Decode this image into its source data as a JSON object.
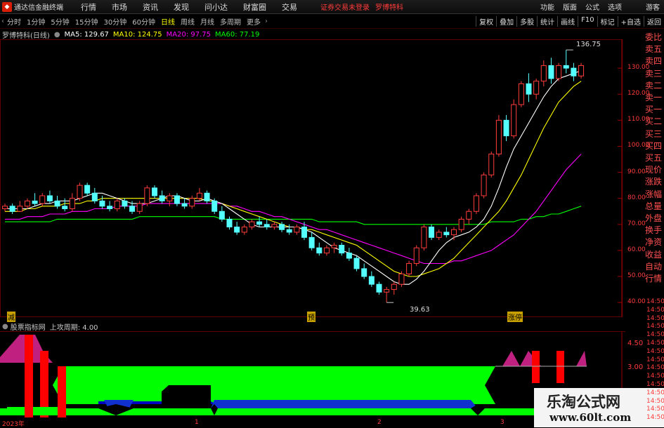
{
  "titlebar": {
    "app_title": "通达信金融终端",
    "menus": [
      "行情",
      "市场",
      "资讯",
      "发现",
      "问小达",
      "财富圈",
      "交易"
    ],
    "alert": "证券交易未登录",
    "stock": "罗博特科",
    "right_menus": [
      "功能",
      "版面",
      "公式",
      "选项"
    ],
    "guest": "游客"
  },
  "toolbar": {
    "periods": [
      "分时",
      "1分钟",
      "5分钟",
      "15分钟",
      "30分钟",
      "60分钟",
      "日线",
      "周线",
      "月线",
      "多周期",
      "更多"
    ],
    "active_period": "日线",
    "right_tools": [
      "复权",
      "叠加",
      "多股",
      "统计",
      "画线",
      "F10",
      "标记",
      "+自选",
      "返回"
    ]
  },
  "chart_info": {
    "stock_label": "罗博特科(日线)",
    "ma5": "MA5: 129.67",
    "ma10": "MA10: 124.75",
    "ma20": "MA20: 97.75",
    "ma60": "MA60: 77.19",
    "high_label": "136.75",
    "low_label": "39.63",
    "marker_left": "减",
    "marker_mid": "预",
    "marker_right": "涨停"
  },
  "side_panel": [
    "委比",
    "卖五",
    "卖四",
    "卖三",
    "卖二",
    "卖一",
    "买一",
    "买二",
    "买三",
    "买四",
    "买五",
    "现价",
    "涨跌",
    "涨幅",
    "总量",
    "外盘",
    "换手",
    "净资",
    "收益",
    "自动",
    "行情"
  ],
  "price_axis": [
    "130.00",
    "120.00",
    "110.00",
    "100.00",
    "90.00",
    "80.00",
    "70.00",
    "60.00",
    "50.00",
    "40.00"
  ],
  "indicator": {
    "name": "股票指标网",
    "param": "上攻周期: 4.00",
    "axis": [
      "4.50",
      "3.00"
    ]
  },
  "time_labels": [
    "2023年",
    "1",
    "2",
    "3"
  ],
  "time_right": [
    "14:50",
    "14:50",
    "14:50",
    "14:50",
    "14:50",
    "14:50",
    "14:50",
    "14:50",
    "14:50",
    "14:50",
    "14:50",
    "14:50",
    "14:50",
    "14:50",
    "14:50"
  ],
  "watermark": {
    "title": "乐淘公式网",
    "url": "www.60lt.com"
  },
  "colors": {
    "up": "#ff3c3c",
    "down": "#54ffff",
    "ma5": "#ffffff",
    "ma10": "#ffff00",
    "ma20": "#ff00ff",
    "ma60": "#00ff00"
  },
  "chart_data": {
    "type": "candlestick",
    "ylim": [
      36,
      140
    ],
    "candles": [
      [
        76,
        78,
        75,
        77
      ],
      [
        77,
        78,
        74,
        75
      ],
      [
        75,
        79,
        75,
        77
      ],
      [
        77,
        80,
        76,
        79
      ],
      [
        79,
        82,
        77,
        78
      ],
      [
        78,
        82,
        77,
        81
      ],
      [
        81,
        83,
        78,
        79
      ],
      [
        79,
        81,
        76,
        77
      ],
      [
        77,
        80,
        75,
        76
      ],
      [
        76,
        82,
        75,
        80
      ],
      [
        80,
        86,
        79,
        85
      ],
      [
        85,
        86,
        81,
        82
      ],
      [
        82,
        84,
        78,
        79
      ],
      [
        79,
        81,
        76,
        77
      ],
      [
        77,
        79,
        75,
        76
      ],
      [
        76,
        80,
        75,
        79
      ],
      [
        79,
        80,
        76,
        77
      ],
      [
        77,
        79,
        74,
        75
      ],
      [
        75,
        79,
        74,
        78
      ],
      [
        78,
        85,
        77,
        84
      ],
      [
        84,
        85,
        80,
        81
      ],
      [
        81,
        83,
        78,
        79
      ],
      [
        79,
        82,
        77,
        81
      ],
      [
        81,
        82,
        77,
        78
      ],
      [
        78,
        80,
        76,
        77
      ],
      [
        77,
        81,
        76,
        80
      ],
      [
        80,
        84,
        79,
        82
      ],
      [
        82,
        83,
        78,
        79
      ],
      [
        79,
        80,
        74,
        75
      ],
      [
        75,
        77,
        71,
        72
      ],
      [
        72,
        73,
        68,
        69
      ],
      [
        69,
        71,
        66,
        67
      ],
      [
        67,
        70,
        66,
        69
      ],
      [
        69,
        72,
        68,
        71
      ],
      [
        71,
        73,
        69,
        70
      ],
      [
        70,
        72,
        68,
        69
      ],
      [
        69,
        71,
        68,
        70
      ],
      [
        70,
        71,
        67,
        68
      ],
      [
        68,
        70,
        66,
        67
      ],
      [
        67,
        70,
        66,
        69
      ],
      [
        69,
        71,
        64,
        65
      ],
      [
        65,
        67,
        60,
        61
      ],
      [
        61,
        63,
        58,
        59
      ],
      [
        59,
        62,
        58,
        61
      ],
      [
        61,
        63,
        59,
        62
      ],
      [
        62,
        63,
        58,
        59
      ],
      [
        59,
        61,
        56,
        57
      ],
      [
        57,
        58,
        52,
        53
      ],
      [
        53,
        55,
        49,
        50
      ],
      [
        50,
        52,
        46,
        47
      ],
      [
        47,
        48,
        43,
        44
      ],
      [
        44,
        46,
        40,
        45
      ],
      [
        45,
        48,
        43,
        47
      ],
      [
        47,
        52,
        46,
        51
      ],
      [
        51,
        56,
        50,
        55
      ],
      [
        55,
        62,
        54,
        61
      ],
      [
        61,
        70,
        60,
        69
      ],
      [
        69,
        70,
        64,
        65
      ],
      [
        65,
        68,
        64,
        67
      ],
      [
        67,
        69,
        65,
        66
      ],
      [
        66,
        69,
        64,
        68
      ],
      [
        68,
        73,
        67,
        72
      ],
      [
        72,
        76,
        70,
        75
      ],
      [
        75,
        82,
        74,
        81
      ],
      [
        81,
        90,
        80,
        89
      ],
      [
        89,
        98,
        88,
        97
      ],
      [
        97,
        112,
        96,
        110
      ],
      [
        110,
        112,
        102,
        104
      ],
      [
        104,
        118,
        103,
        116
      ],
      [
        116,
        125,
        115,
        124
      ],
      [
        124,
        128,
        117,
        120
      ],
      [
        120,
        126,
        118,
        125
      ],
      [
        125,
        133,
        123,
        131
      ],
      [
        131,
        134,
        124,
        126
      ],
      [
        126,
        132,
        125,
        131
      ],
      [
        131,
        137,
        128,
        130
      ],
      [
        130,
        132,
        125,
        127
      ],
      [
        127,
        132,
        126,
        131
      ]
    ],
    "ma": {
      "ma5": [
        76,
        76,
        76,
        76,
        77,
        78,
        78,
        79,
        79,
        79,
        80,
        81,
        82,
        82,
        81,
        80,
        79,
        78,
        78,
        78,
        79,
        80,
        81,
        81,
        80,
        79,
        79,
        80,
        79,
        78,
        76,
        74,
        72,
        70,
        69,
        69,
        69,
        69,
        69,
        69,
        68,
        67,
        65,
        63,
        61,
        60,
        59,
        58,
        56,
        54,
        52,
        50,
        48,
        47,
        47,
        49,
        52,
        56,
        60,
        63,
        65,
        66,
        67,
        69,
        72,
        77,
        84,
        92,
        99,
        104,
        109,
        114,
        119,
        123,
        126,
        127,
        128,
        129
      ],
      "ma10": [
        75,
        75,
        75,
        76,
        76,
        77,
        77,
        77,
        78,
        78,
        78,
        79,
        79,
        80,
        80,
        80,
        80,
        80,
        80,
        80,
        80,
        80,
        80,
        80,
        80,
        80,
        80,
        79,
        79,
        78,
        77,
        76,
        75,
        74,
        73,
        72,
        71,
        70,
        69,
        69,
        68,
        68,
        67,
        66,
        65,
        64,
        63,
        62,
        60,
        58,
        56,
        54,
        52,
        51,
        50,
        50,
        51,
        52,
        53,
        55,
        57,
        60,
        63,
        66,
        69,
        72,
        75,
        79,
        84,
        89,
        95,
        101,
        107,
        112,
        117,
        120,
        123,
        125
      ],
      "ma20": [
        72,
        72,
        72,
        73,
        73,
        73,
        74,
        74,
        74,
        75,
        75,
        75,
        76,
        76,
        76,
        77,
        77,
        77,
        77,
        78,
        78,
        78,
        78,
        78,
        78,
        78,
        78,
        78,
        78,
        78,
        77,
        77,
        76,
        75,
        75,
        74,
        73,
        73,
        72,
        71,
        70,
        69,
        68,
        68,
        67,
        66,
        65,
        64,
        63,
        62,
        61,
        60,
        59,
        58,
        57,
        56,
        55,
        55,
        55,
        55,
        56,
        56,
        57,
        58,
        59,
        60,
        62,
        64,
        66,
        69,
        72,
        75,
        79,
        83,
        87,
        91,
        94,
        97
      ],
      "ma60": [
        71,
        71,
        71,
        71,
        71,
        71,
        71,
        72,
        72,
        72,
        72,
        72,
        72,
        72,
        72,
        72,
        72,
        72,
        73,
        73,
        73,
        73,
        73,
        73,
        73,
        73,
        73,
        73,
        73,
        72,
        72,
        72,
        72,
        72,
        72,
        72,
        72,
        72,
        72,
        72,
        72,
        72,
        71,
        71,
        71,
        71,
        71,
        71,
        70,
        70,
        70,
        70,
        70,
        70,
        70,
        70,
        70,
        70,
        70,
        70,
        70,
        70,
        70,
        70,
        70,
        71,
        71,
        71,
        71,
        72,
        72,
        73,
        73,
        74,
        74,
        75,
        76,
        77
      ]
    }
  }
}
